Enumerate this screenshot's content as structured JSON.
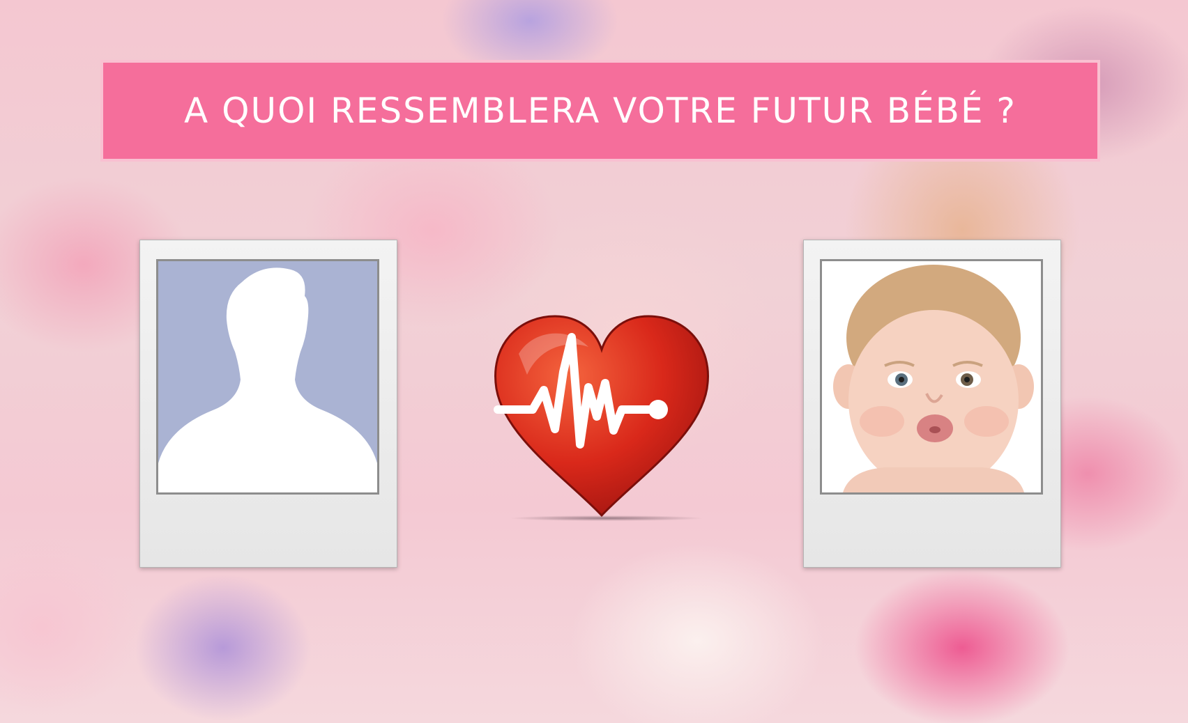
{
  "title": "A QUOI RESSEMBLERA VOTRE FUTUR BÉBÉ ?",
  "colors": {
    "banner": "#f56e9b",
    "banner_border": "#f9c0d1",
    "heart": "#e0301e",
    "silhouette_bg": "#aab3d3"
  },
  "cards": {
    "left": {
      "icon": "person-silhouette-icon"
    },
    "right": {
      "icon": "baby-photo"
    }
  },
  "center_icon": "heartbeat-heart-icon"
}
